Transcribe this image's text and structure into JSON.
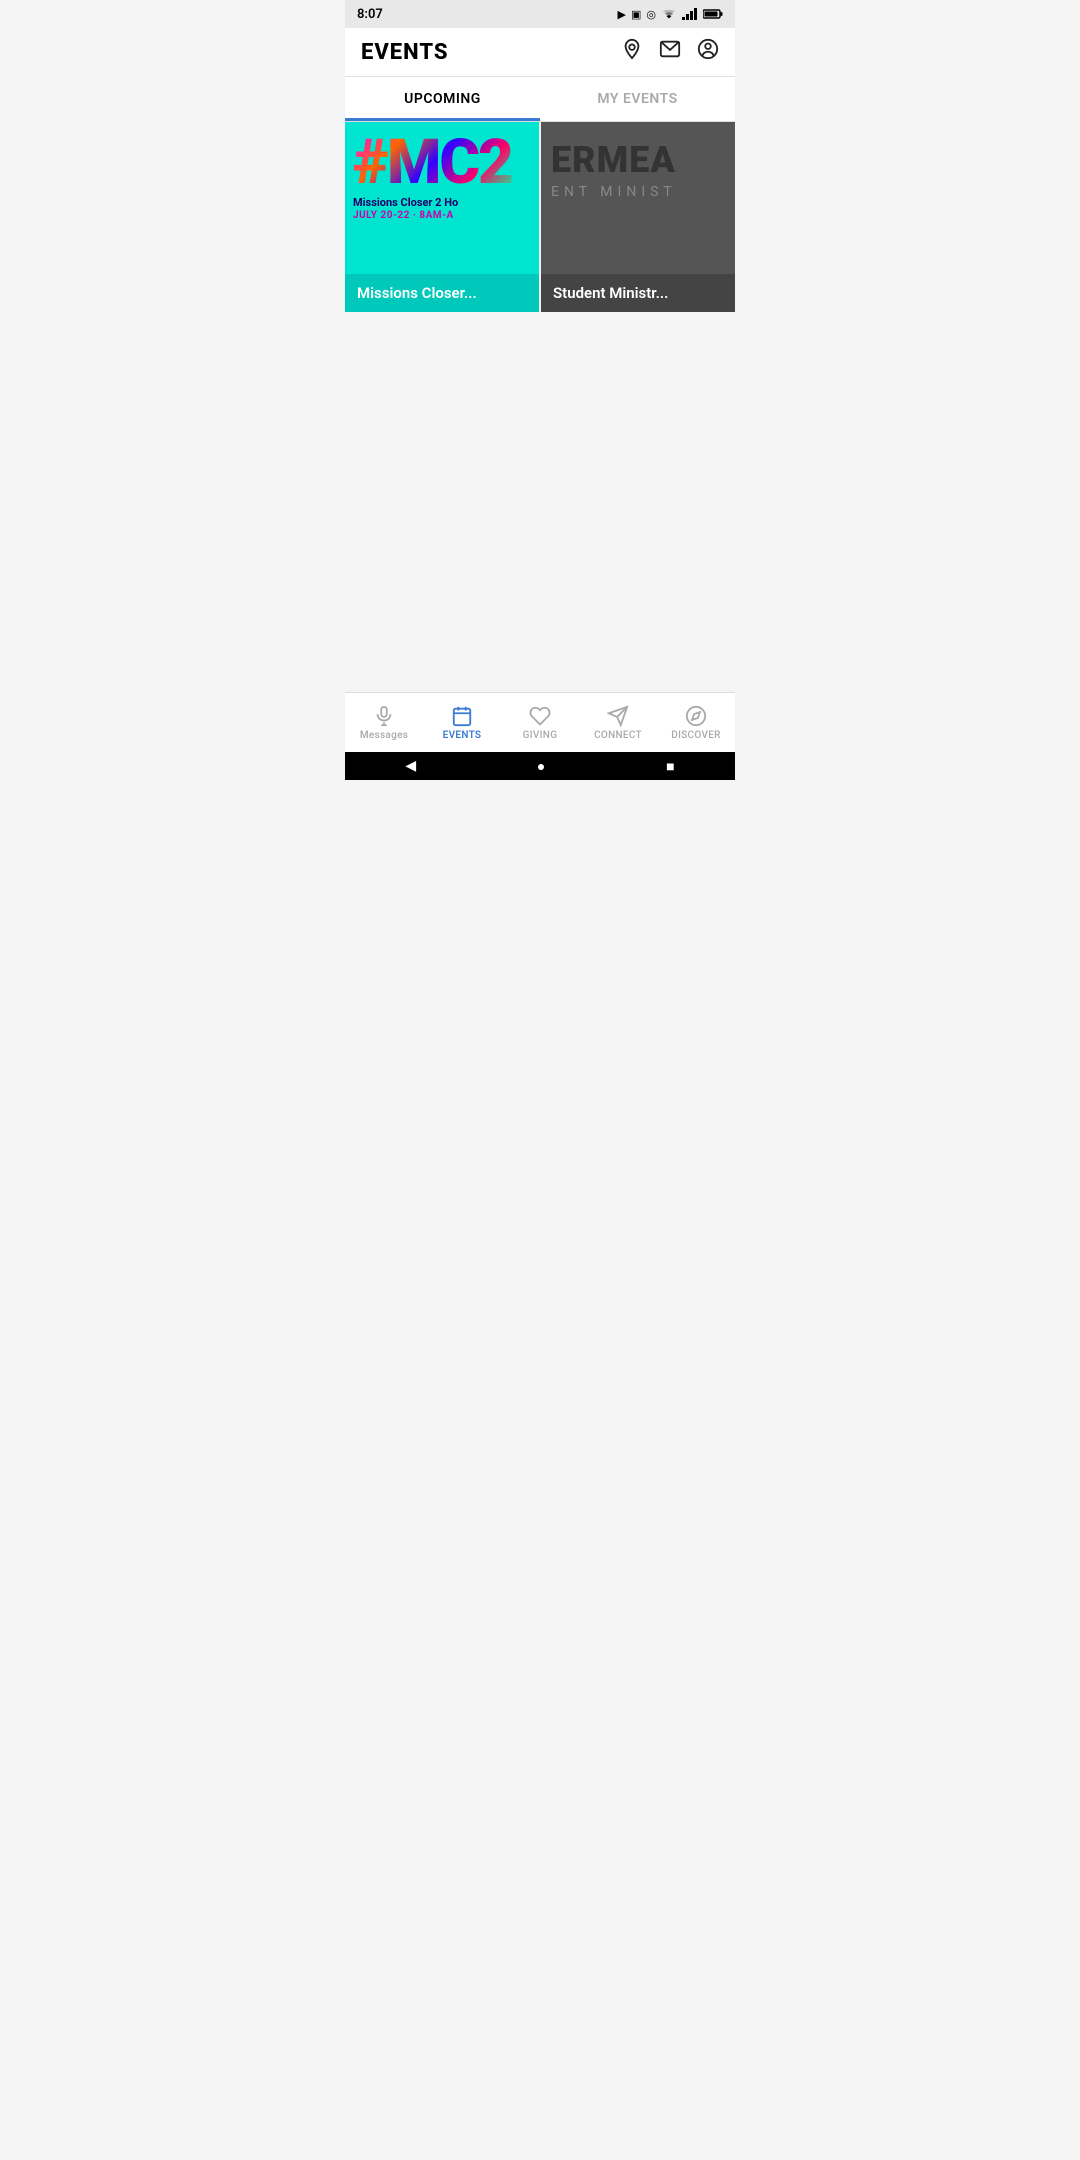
{
  "statusBar": {
    "time": "8:07",
    "icons": [
      "▶",
      "▣",
      "◎"
    ]
  },
  "header": {
    "title": "EVENTS",
    "icons": {
      "location": "location-icon",
      "mail": "mail-icon",
      "user": "user-icon"
    }
  },
  "tabs": [
    {
      "id": "upcoming",
      "label": "UPCOMING",
      "active": true
    },
    {
      "id": "my-events",
      "label": "MY EVENTS",
      "active": false
    }
  ],
  "events": [
    {
      "id": "missions-closer",
      "hashtag": "#MC2",
      "title_line1": "Missions Closer 2 Ho",
      "date": "July 20-22 · 8AM-A",
      "label": "Missions Closer...",
      "bg": "cyan"
    },
    {
      "id": "student-ministry",
      "big_text": "ERMEA",
      "sub_text": "ENT MINIST",
      "label": "Student Ministr...",
      "bg": "dark"
    }
  ],
  "bottomNav": [
    {
      "id": "messages",
      "label": "Messages",
      "icon": "mic",
      "active": false
    },
    {
      "id": "events",
      "label": "EVENTS",
      "icon": "calendar",
      "active": true
    },
    {
      "id": "giving",
      "label": "GIVING",
      "icon": "heart",
      "active": false
    },
    {
      "id": "connect",
      "label": "CONNECT",
      "icon": "send",
      "active": false
    },
    {
      "id": "discover",
      "label": "DISCOVER",
      "icon": "compass",
      "active": false
    }
  ],
  "androidNav": {
    "back": "◀",
    "home": "●",
    "recent": "■"
  }
}
